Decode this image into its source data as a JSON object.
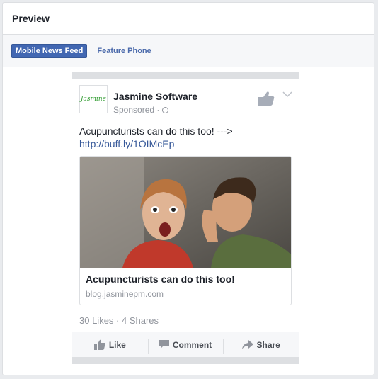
{
  "panel": {
    "title": "Preview"
  },
  "tabs": [
    {
      "label": "Mobile News Feed",
      "active": true
    },
    {
      "label": "Feature Phone",
      "active": false
    }
  ],
  "post": {
    "avatar_text": "Jasmine",
    "page_name": "Jasmine Software",
    "sponsored": "Sponsored · ",
    "message": "Acupuncturists can do this too! --->",
    "link": "http://buff.ly/1OIMcEp",
    "card": {
      "title": "Acupuncturists can do this too!",
      "domain": "blog.jasminepm.com"
    },
    "stats": "30 Likes · 4 Shares",
    "actions": {
      "like": "Like",
      "comment": "Comment",
      "share": "Share"
    }
  },
  "colors": {
    "accent": "#4267b2",
    "link": "#365899",
    "muted": "#90949c"
  },
  "icons": [
    "globe-icon",
    "like-thumb-icon",
    "chevron-down-icon",
    "comment-icon",
    "share-icon"
  ]
}
